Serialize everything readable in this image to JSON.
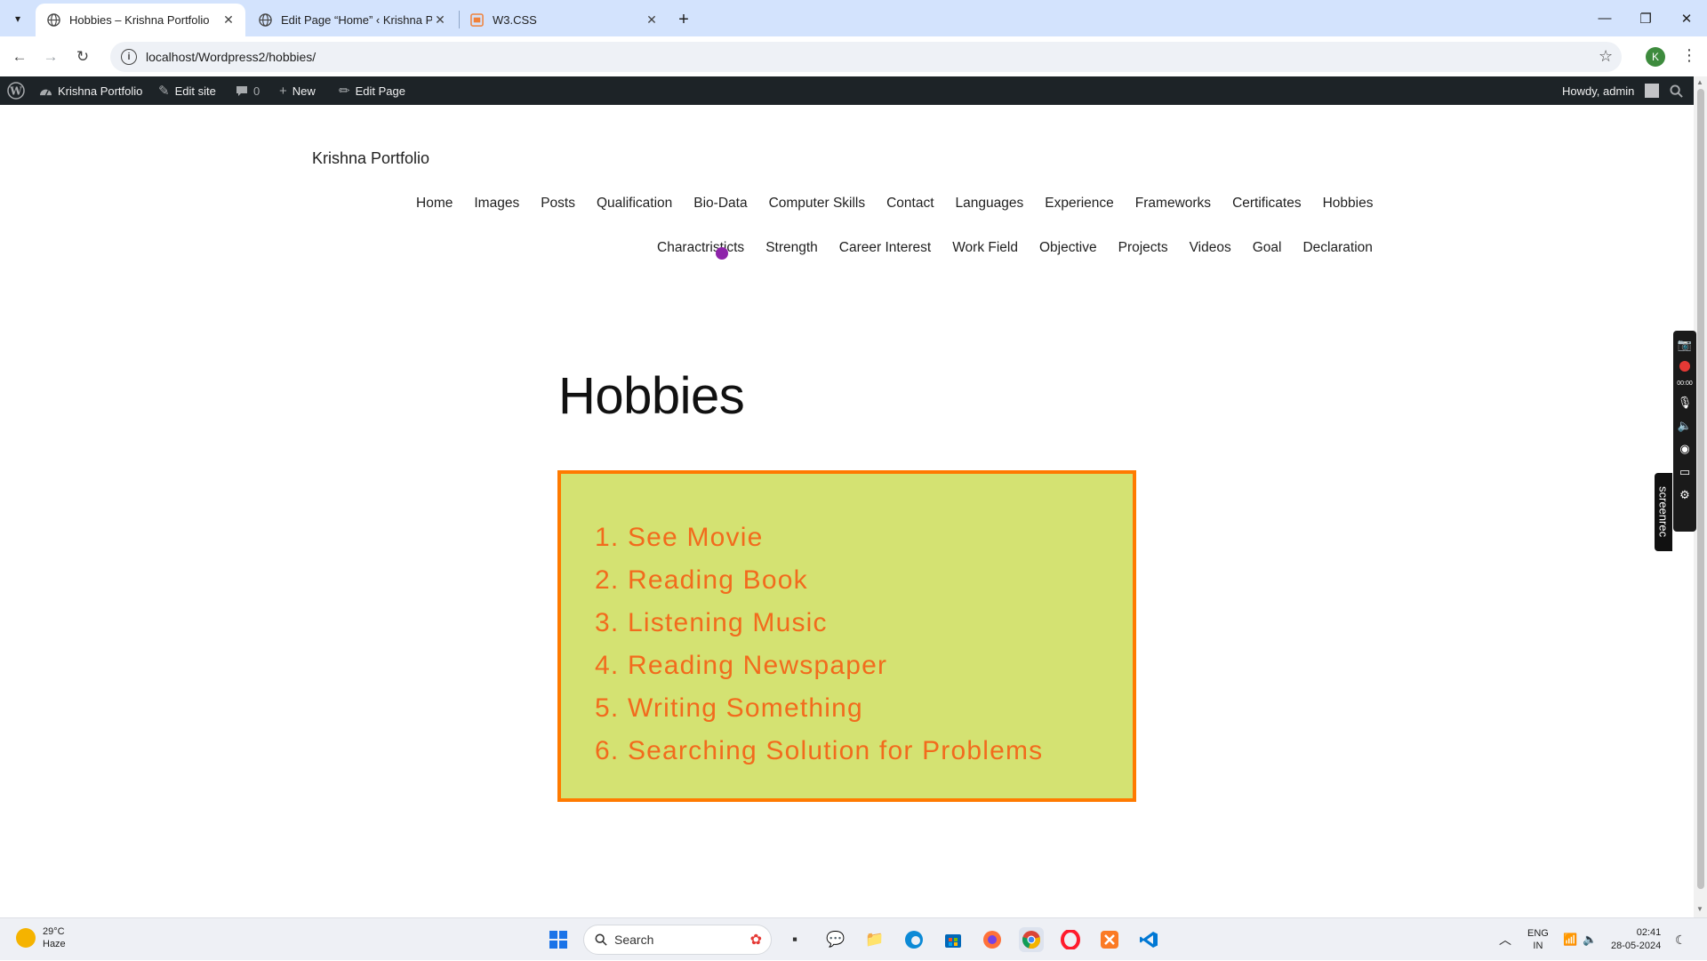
{
  "browser": {
    "tabs": [
      {
        "title": "Hobbies – Krishna Portfolio",
        "active": true
      },
      {
        "title": "Edit Page “Home” ‹ Krishna Por",
        "active": false
      },
      {
        "title": "W3.CSS",
        "active": false
      }
    ],
    "url": "localhost/Wordpress2/hobbies/",
    "profile_initial": "K"
  },
  "adminbar": {
    "site_name": "Krishna Portfolio",
    "edit_site": "Edit site",
    "comments_count": "0",
    "new_label": "New",
    "edit_page": "Edit Page",
    "howdy": "Howdy, admin"
  },
  "site": {
    "title": "Krishna Portfolio",
    "nav_row1": [
      "Home",
      "Images",
      "Posts",
      "Qualification",
      "Bio-Data",
      "Computer Skills",
      "Contact",
      "Languages",
      "Experience",
      "Frameworks",
      "Certificates",
      "Hobbies"
    ],
    "nav_row2": [
      "Charactristicts",
      "Strength",
      "Career Interest",
      "Work Field",
      "Objective",
      "Projects",
      "Videos",
      "Goal",
      "Declaration"
    ]
  },
  "page": {
    "heading": "Hobbies",
    "hobbies": [
      "1. See Movie",
      "2. Reading Book",
      "3. Listening Music",
      "4. Reading Newspaper",
      "5. Writing Something",
      "6. Searching Solution for Problems"
    ]
  },
  "screenrec": {
    "label": "screenrec",
    "timer": "00:00"
  },
  "taskbar": {
    "weather_temp": "29°C",
    "weather_desc": "Haze",
    "search_label": "Search",
    "lang_top": "ENG",
    "lang_bottom": "IN",
    "time": "02:41",
    "date": "28-05-2024"
  },
  "colors": {
    "box_bg": "#d4e272",
    "box_border": "#ff7a00",
    "hobby_text": "#f26b1d",
    "adminbar_bg": "#1d2327",
    "tabstrip_bg": "#d3e3fd"
  }
}
